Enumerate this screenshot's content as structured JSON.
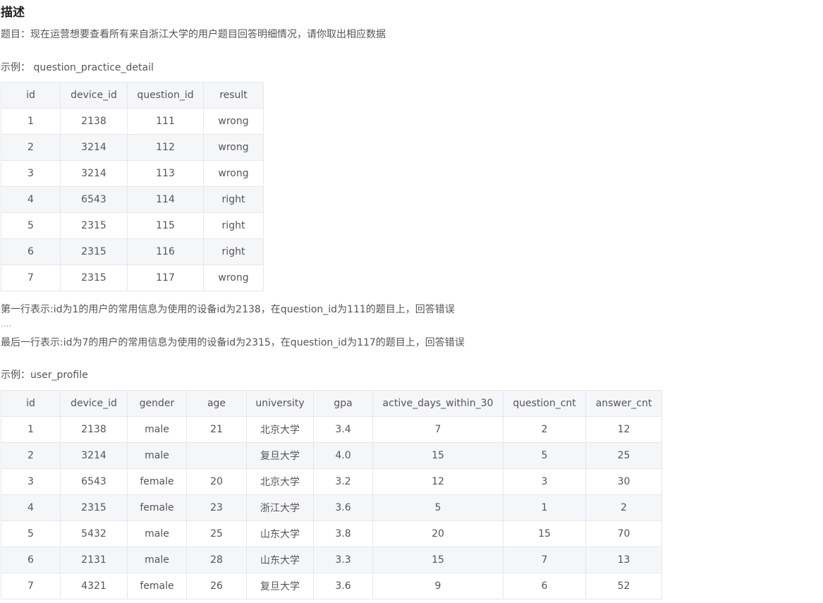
{
  "heading": "描述",
  "question": "题目：现在运营想要查看所有来自浙江大学的用户题目回答明细情况，请你取出相应数据",
  "example1": {
    "label": "示例： question_practice_detail",
    "columns": [
      "id",
      "device_id",
      "question_id",
      "result"
    ],
    "rows": [
      [
        "1",
        "2138",
        "111",
        "wrong"
      ],
      [
        "2",
        "3214",
        "112",
        "wrong"
      ],
      [
        "3",
        "3214",
        "113",
        "wrong"
      ],
      [
        "4",
        "6543",
        "114",
        "right"
      ],
      [
        "5",
        "2315",
        "115",
        "right"
      ],
      [
        "6",
        "2315",
        "116",
        "right"
      ],
      [
        "7",
        "2315",
        "117",
        "wrong"
      ]
    ]
  },
  "notes": {
    "first_row": "第一行表示:id为1的用户的常用信息为使用的设备id为2138，在question_id为111的题目上，回答错误",
    "ellipsis": "....",
    "last_row": "最后一行表示:id为7的用户的常用信息为使用的设备id为2315，在question_id为117的题目上，回答错误"
  },
  "example2": {
    "label": "示例：user_profile",
    "columns": [
      "id",
      "device_id",
      "gender",
      "age",
      "university",
      "gpa",
      "active_days_within_30",
      "question_cnt",
      "answer_cnt"
    ],
    "rows": [
      [
        "1",
        "2138",
        "male",
        "21",
        "北京大学",
        "3.4",
        "7",
        "2",
        "12"
      ],
      [
        "2",
        "3214",
        "male",
        "",
        "复旦大学",
        "4.0",
        "15",
        "5",
        "25"
      ],
      [
        "3",
        "6543",
        "female",
        "20",
        "北京大学",
        "3.2",
        "12",
        "3",
        "30"
      ],
      [
        "4",
        "2315",
        "female",
        "23",
        "浙江大学",
        "3.6",
        "5",
        "1",
        "2"
      ],
      [
        "5",
        "5432",
        "male",
        "25",
        "山东大学",
        "3.8",
        "20",
        "15",
        "70"
      ],
      [
        "6",
        "2131",
        "male",
        "28",
        "山东大学",
        "3.3",
        "15",
        "7",
        "13"
      ],
      [
        "7",
        "4321",
        "female",
        "26",
        "复旦大学",
        "3.6",
        "9",
        "6",
        "52"
      ]
    ]
  }
}
